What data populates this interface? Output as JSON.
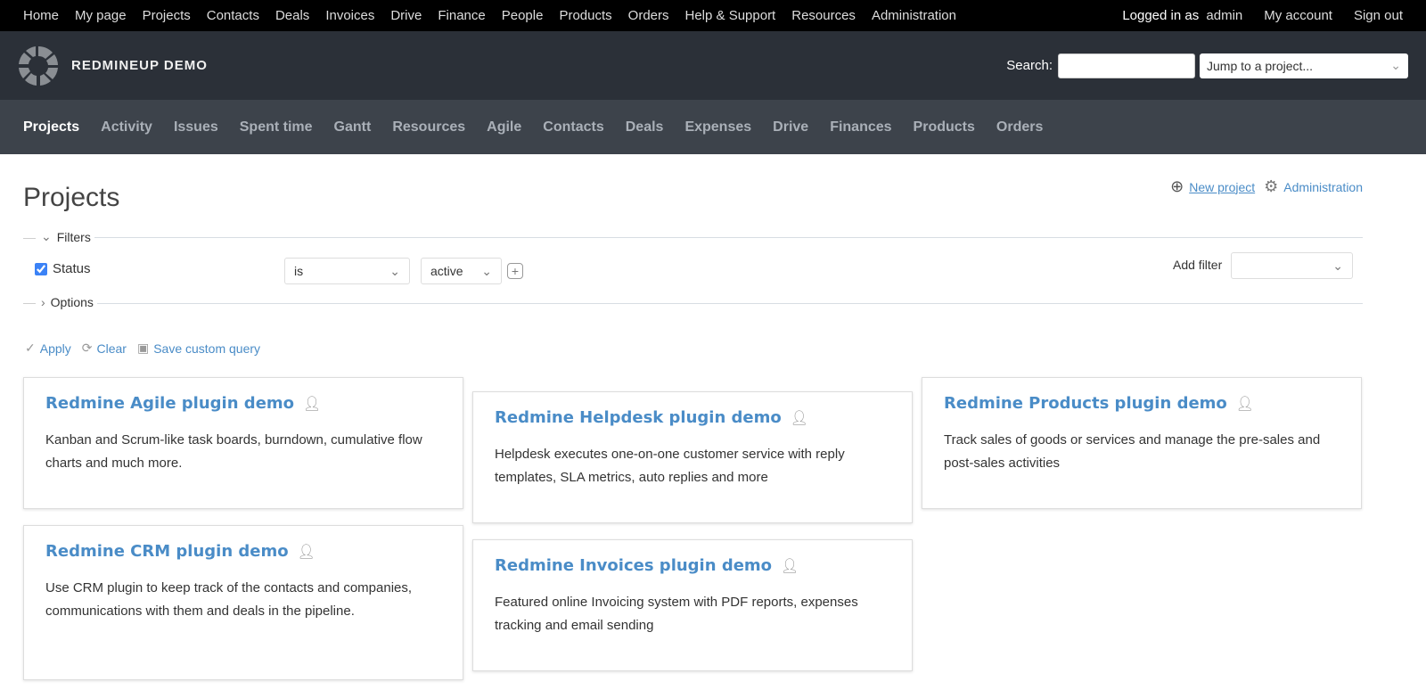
{
  "top_menu": {
    "items": [
      "Home",
      "My page",
      "Projects",
      "Contacts",
      "Deals",
      "Invoices",
      "Drive",
      "Finance",
      "People",
      "Products",
      "Orders",
      "Help & Support",
      "Resources",
      "Administration"
    ],
    "logged_in_prefix": "Logged in as",
    "user": "admin",
    "my_account": "My account",
    "sign_out": "Sign out"
  },
  "header": {
    "brand": "REDMINEUP DEMO",
    "search_label": "Search:",
    "search_value": "",
    "jump": "Jump to a project..."
  },
  "main_menu": {
    "items": [
      "Projects",
      "Activity",
      "Issues",
      "Spent time",
      "Gantt",
      "Resources",
      "Agile",
      "Contacts",
      "Deals",
      "Expenses",
      "Drive",
      "Finances",
      "Products",
      "Orders"
    ]
  },
  "page": {
    "title": "Projects",
    "new_project": "New project",
    "administration": "Administration"
  },
  "filters": {
    "legend": "Filters",
    "status_label": "Status",
    "status_checked": true,
    "operator": "is",
    "value": "active",
    "add_filter_label": "Add filter",
    "add_filter_value": ""
  },
  "options": {
    "legend": "Options"
  },
  "actions": {
    "apply": "Apply",
    "clear": "Clear",
    "save": "Save custom query"
  },
  "projects": [
    {
      "name": "Redmine Agile plugin demo",
      "desc": "Kanban and Scrum-like task boards, burndown, cumulative flow charts and much more."
    },
    {
      "name": "Redmine Helpdesk plugin demo",
      "desc": "Helpdesk executes one-on-one customer service with reply templates, SLA metrics, auto replies and more"
    },
    {
      "name": "Redmine Products plugin demo",
      "desc": "Track sales of goods or services and manage the pre-sales and post-sales activities"
    },
    {
      "name": "Redmine CRM plugin demo",
      "desc": "Use CRM plugin to keep track of the contacts and companies, communications with them and deals in the pipeline."
    },
    {
      "name": "Redmine Invoices plugin demo",
      "desc": "Featured online Invoicing system with PDF reports, expenses tracking and email sending"
    }
  ]
}
